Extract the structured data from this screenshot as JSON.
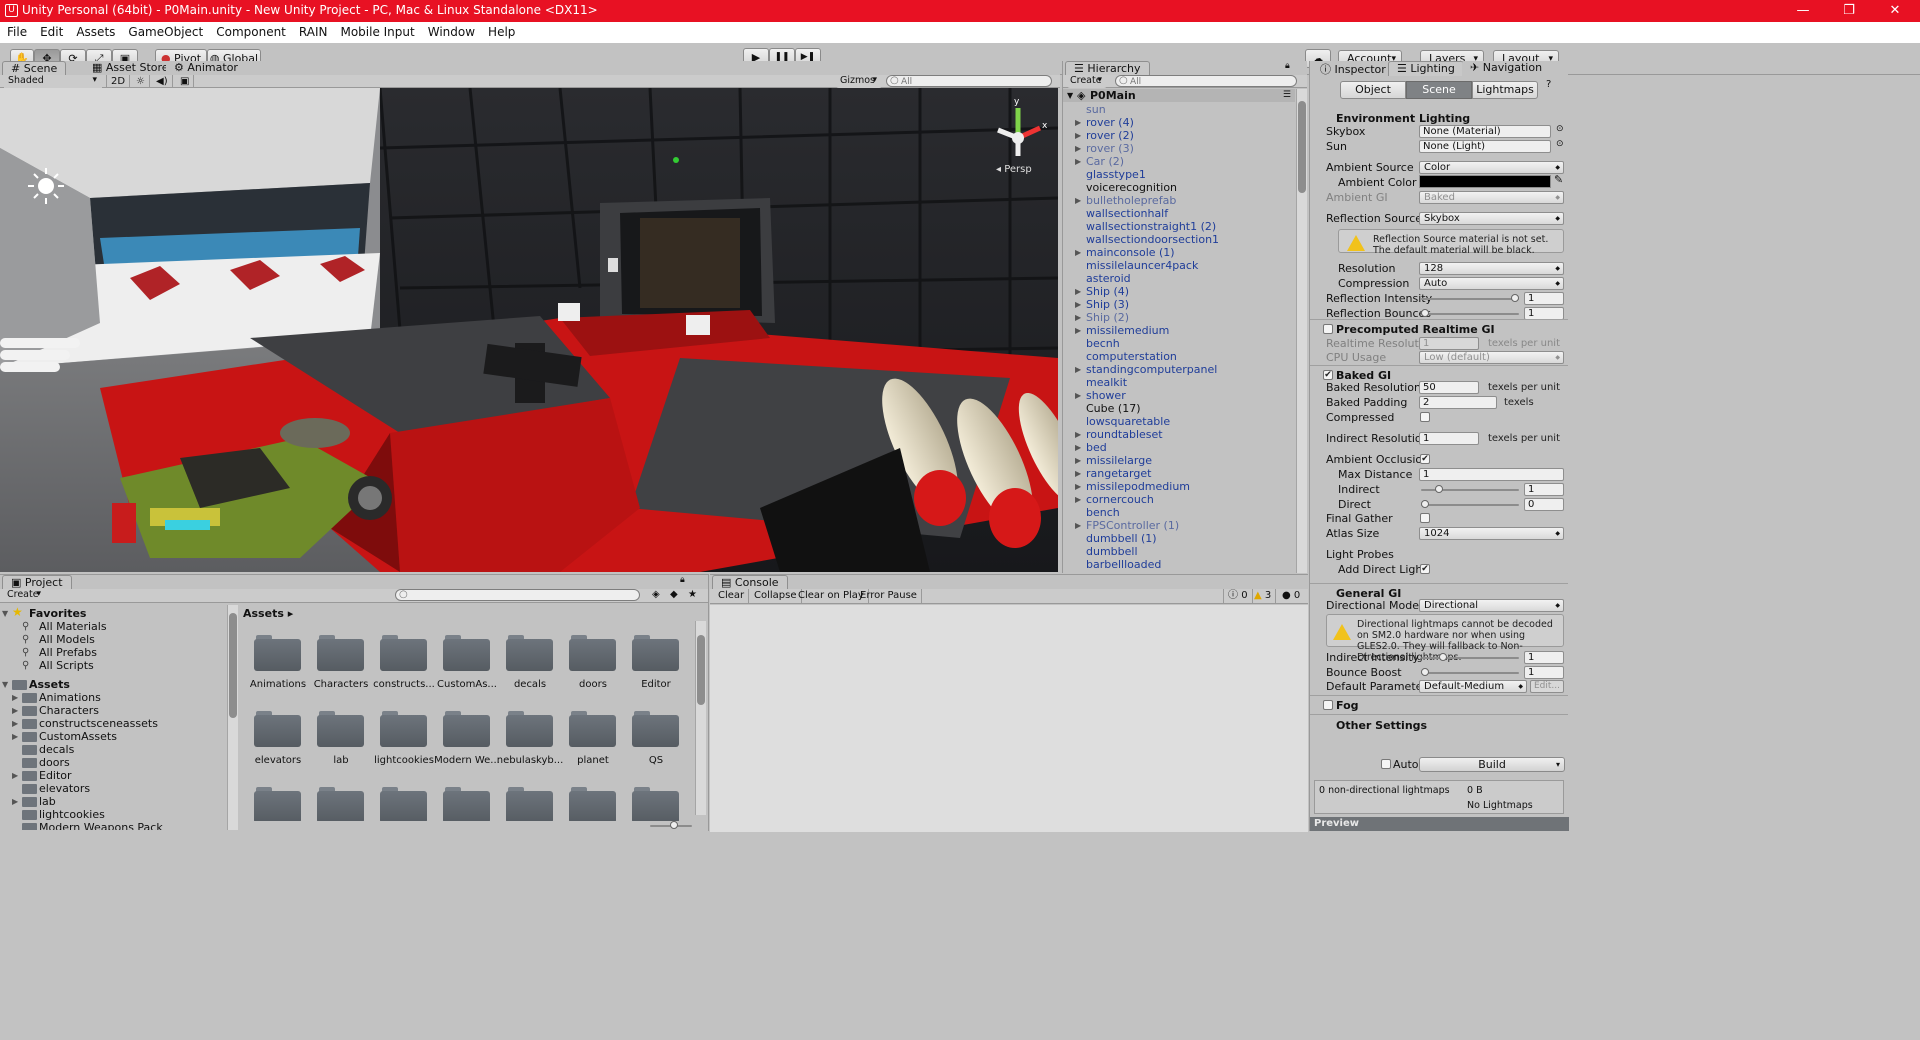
{
  "window": {
    "title": "Unity Personal (64bit) - P0Main.unity - New Unity Project - PC, Mac & Linux Standalone <DX11>",
    "logo": "U",
    "minimize": "—",
    "maximize": "❐",
    "close": "✕"
  },
  "menu": [
    "File",
    "Edit",
    "Assets",
    "GameObject",
    "Component",
    "RAIN",
    "Mobile Input",
    "Window",
    "Help"
  ],
  "toolbar": {
    "tools": [
      "hand-icon",
      "move-icon",
      "rotate-icon",
      "scale-icon",
      "rect-icon"
    ],
    "tool_glyphs": [
      "✋",
      "✥",
      "⟳",
      "⤢",
      "▣"
    ],
    "pivot": "Pivot",
    "global": "Global",
    "play": "▶",
    "pause": "❚❚",
    "step": "▶❚",
    "cloud": "☁",
    "account": "Account",
    "layers": "Layers",
    "layout": "Layout"
  },
  "scene_panel": {
    "tabs": [
      "Scene",
      "Asset Store",
      "Animator"
    ],
    "shading": "Shaded",
    "mode2d": "2D",
    "sun": "☼",
    "audio": "◀)",
    "fx": "▣",
    "gizmos": "Gizmos",
    "search": "All",
    "persp": "Persp",
    "axis_y": "y",
    "axis_x": "x"
  },
  "hierarchy": {
    "tab": "Hierarchy",
    "create": "Create",
    "search": "All",
    "scene": "P0Main",
    "items": [
      {
        "label": "sun",
        "arrow": "",
        "dim": true
      },
      {
        "label": "rover (4)",
        "arrow": "▶",
        "dim": false
      },
      {
        "label": "rover (2)",
        "arrow": "▶",
        "dim": false
      },
      {
        "label": "rover (3)",
        "arrow": "▶",
        "dim": true
      },
      {
        "label": "Car (2)",
        "arrow": "▶",
        "dim": true
      },
      {
        "label": "glasstype1",
        "arrow": "",
        "dim": false
      },
      {
        "label": "voicerecognition",
        "arrow": "",
        "dim": false,
        "black": true
      },
      {
        "label": "bulletholeprefab",
        "arrow": "▶",
        "dim": true
      },
      {
        "label": "wallsectionhalf",
        "arrow": "",
        "dim": false
      },
      {
        "label": "wallsectionstraight1 (2)",
        "arrow": "",
        "dim": false
      },
      {
        "label": "wallsectiondoorsection1",
        "arrow": "",
        "dim": false
      },
      {
        "label": "mainconsole (1)",
        "arrow": "▶",
        "dim": false
      },
      {
        "label": "missilelauncer4pack",
        "arrow": "",
        "dim": false
      },
      {
        "label": "asteroid",
        "arrow": "",
        "dim": false
      },
      {
        "label": "Ship (4)",
        "arrow": "▶",
        "dim": false
      },
      {
        "label": "Ship (3)",
        "arrow": "▶",
        "dim": false
      },
      {
        "label": "Ship (2)",
        "arrow": "▶",
        "dim": true
      },
      {
        "label": "missilemedium",
        "arrow": "▶",
        "dim": false
      },
      {
        "label": "becnh",
        "arrow": "",
        "dim": false
      },
      {
        "label": "computerstation",
        "arrow": "",
        "dim": false
      },
      {
        "label": "standingcomputerpanel",
        "arrow": "▶",
        "dim": false
      },
      {
        "label": "mealkit",
        "arrow": "",
        "dim": false
      },
      {
        "label": "shower",
        "arrow": "▶",
        "dim": false
      },
      {
        "label": "Cube (17)",
        "arrow": "",
        "dim": false,
        "black": true
      },
      {
        "label": "lowsquaretable",
        "arrow": "",
        "dim": false
      },
      {
        "label": "roundtableset",
        "arrow": "▶",
        "dim": false
      },
      {
        "label": "bed",
        "arrow": "▶",
        "dim": false
      },
      {
        "label": "missilelarge",
        "arrow": "▶",
        "dim": false
      },
      {
        "label": "rangetarget",
        "arrow": "▶",
        "dim": false
      },
      {
        "label": "missilepodmedium",
        "arrow": "▶",
        "dim": false
      },
      {
        "label": "cornercouch",
        "arrow": "▶",
        "dim": false
      },
      {
        "label": "bench",
        "arrow": "",
        "dim": false
      },
      {
        "label": "FPSController (1)",
        "arrow": "▶",
        "dim": true
      },
      {
        "label": "dumbbell (1)",
        "arrow": "",
        "dim": false
      },
      {
        "label": "dumbbell",
        "arrow": "",
        "dim": false
      },
      {
        "label": "barbellloaded",
        "arrow": "",
        "dim": false
      }
    ]
  },
  "inspector": {
    "tabs": [
      "Inspector",
      "Lighting",
      "Navigation"
    ],
    "subtabs": [
      "Object",
      "Scene",
      "Lightmaps"
    ],
    "env_title": "Environment Lighting",
    "skybox_label": "Skybox",
    "skybox_value": "None (Material)",
    "sun_label": "Sun",
    "sun_value": "None (Light)",
    "ambient_source_label": "Ambient Source",
    "ambient_source_value": "Color",
    "ambient_color_label": "Ambient Color",
    "ambient_gi_label": "Ambient GI",
    "ambient_gi_value": "Baked",
    "reflection_source_label": "Reflection Source",
    "reflection_source_value": "Skybox",
    "reflection_warning": "Reflection Source material is not set. The default material will be black.",
    "resolution_label": "Resolution",
    "resolution_value": "128",
    "compression_label": "Compression",
    "compression_value": "Auto",
    "refl_intensity_label": "Reflection Intensity",
    "refl_intensity_value": "1",
    "refl_bounces_label": "Reflection Bounces",
    "refl_bounces_value": "1",
    "precomp_title": "Precomputed Realtime GI",
    "rt_res_label": "Realtime Resolution",
    "rt_res_value": "1",
    "texels_per_unit": "texels per unit",
    "cpu_label": "CPU Usage",
    "cpu_value": "Low (default)",
    "baked_title": "Baked GI",
    "baked_res_label": "Baked Resolution",
    "baked_res_value": "50",
    "baked_pad_label": "Baked Padding",
    "baked_pad_value": "2",
    "texels": "texels",
    "compressed_label": "Compressed",
    "indirect_res_label": "Indirect Resolution",
    "indirect_res_value": "1",
    "ao_label": "Ambient Occlusion",
    "max_dist_label": "Max Distance",
    "max_dist_value": "1",
    "indirect_label": "Indirect",
    "indirect_value": "1",
    "direct_label": "Direct",
    "direct_value": "0",
    "final_gather_label": "Final Gather",
    "atlas_label": "Atlas Size",
    "atlas_value": "1024",
    "light_probes_label": "Light Probes",
    "add_direct_label": "Add Direct Light",
    "general_title": "General GI",
    "dir_mode_label": "Directional Mode",
    "dir_mode_value": "Directional",
    "dir_warning": "Directional lightmaps cannot be decoded on SM2.0 hardware nor when using GLES2.0. They will fallback to Non-Directional lightmaps.",
    "ind_intensity_label": "Indirect Intensity",
    "ind_intensity_value": "1",
    "bounce_label": "Bounce Boost",
    "bounce_value": "1",
    "default_params_label": "Default Parameters",
    "default_params_value": "Default-Medium",
    "edit": "Edit...",
    "fog_title": "Fog",
    "other_title": "Other Settings",
    "auto_label": "Auto",
    "build_label": "Build",
    "nondir_label": "0 non-directional lightmaps",
    "nondir_size": "0 B",
    "no_lightmaps": "No Lightmaps",
    "preview": "Preview",
    "reflection_intensity_level": 1,
    "reflection_bounces_level": 0,
    "indirect_level": 0.15,
    "direct_level": 0,
    "indirect_intensity_level": 0.2,
    "bounce_boost_level": 0,
    "checks": {
      "precomputed": false,
      "baked": true,
      "compressed": false,
      "ao": true,
      "final_gather": false,
      "add_direct": true,
      "fog": false,
      "auto": false
    }
  },
  "project": {
    "tab": "Project",
    "create": "Create",
    "favorites": "Favorites",
    "fav_items": [
      "All Materials",
      "All Models",
      "All Prefabs",
      "All Scripts"
    ],
    "assets_root": "Assets",
    "asset_tree": [
      "Animations",
      "Characters",
      "constructsceneassets",
      "CustomAssets",
      "decals",
      "doors",
      "Editor",
      "elevators",
      "lab",
      "lightcookies",
      "Modern Weapons Pack"
    ],
    "breadcrumb": "Assets ▸",
    "grid_row1": [
      "Animations",
      "Characters",
      "constructs...",
      "CustomAs...",
      "decals",
      "doors",
      "Editor"
    ],
    "grid_row2": [
      "elevators",
      "lab",
      "lightcookies",
      "Modern We...",
      "nebulaskyb...",
      "planet",
      "QS"
    ]
  },
  "console": {
    "tab": "Console",
    "buttons": [
      "Clear",
      "Collapse",
      "Clear on Play",
      "Error Pause"
    ],
    "info_count": "0",
    "warn_count": "3",
    "error_count": "0"
  }
}
